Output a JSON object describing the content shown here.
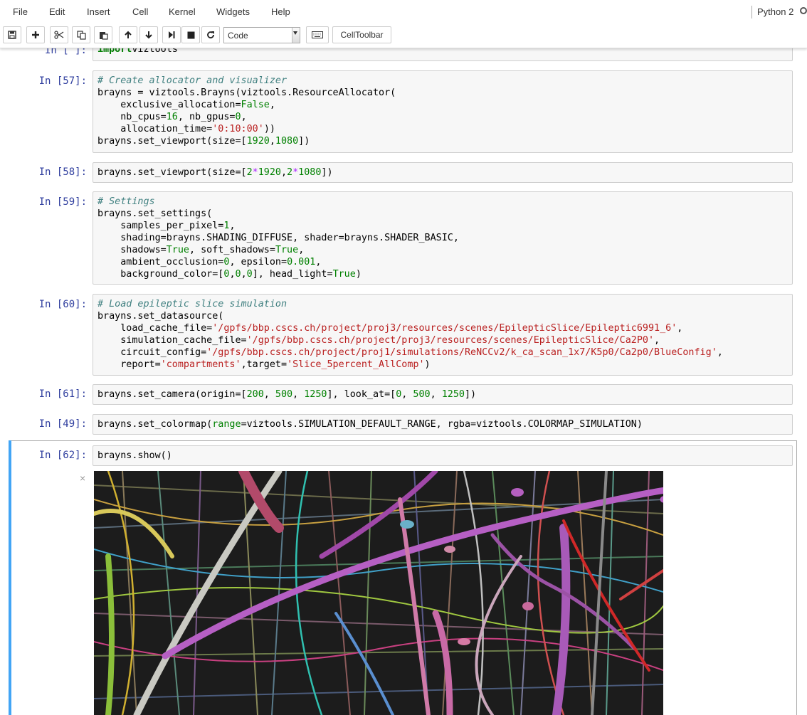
{
  "menubar": {
    "items": [
      "File",
      "Edit",
      "Insert",
      "Cell",
      "Kernel",
      "Widgets",
      "Help"
    ],
    "kernel": "Python 2"
  },
  "toolbar": {
    "icons": [
      "save-icon",
      "insert-cell-below-icon",
      "cut-icon",
      "copy-icon",
      "paste-icon",
      "move-up-icon",
      "move-down-icon",
      "run-cell-icon",
      "interrupt-kernel-icon",
      "restart-kernel-icon",
      "keyboard-icon"
    ],
    "cell_type": "Code",
    "celltoolbar_label": "CellToolbar"
  },
  "cells": [
    {
      "prompt": "In [ ]:",
      "lines": [
        [
          [
            "kw",
            "import"
          ],
          [
            "",
            "viztools"
          ]
        ]
      ]
    },
    {
      "prompt": "In [57]:",
      "lines": [
        [
          [
            "cm",
            "# Create allocator and visualizer"
          ]
        ],
        [
          [
            "",
            "brayns = viztools.Brayns(viztools.ResourceAllocator("
          ]
        ],
        [
          [
            "",
            "    exclusive_allocation="
          ],
          [
            "num",
            "False"
          ],
          [
            "",
            ","
          ]
        ],
        [
          [
            "",
            "    nb_cpus="
          ],
          [
            "num",
            "16"
          ],
          [
            "",
            ", nb_gpus="
          ],
          [
            "num",
            "0"
          ],
          [
            "",
            ","
          ]
        ],
        [
          [
            "",
            "    allocation_time="
          ],
          [
            "str",
            "'0:10:00'"
          ],
          [
            "",
            "))"
          ]
        ],
        [
          [
            "",
            "brayns.set_viewport(size=["
          ],
          [
            "num",
            "1920"
          ],
          [
            "",
            ","
          ],
          [
            "num",
            "1080"
          ],
          [
            "",
            "])"
          ]
        ]
      ]
    },
    {
      "prompt": "In [58]:",
      "lines": [
        [
          [
            "",
            "brayns.set_viewport(size=["
          ],
          [
            "num",
            "2"
          ],
          [
            "op",
            "*"
          ],
          [
            "num",
            "1920"
          ],
          [
            "",
            ","
          ],
          [
            "num",
            "2"
          ],
          [
            "op",
            "*"
          ],
          [
            "num",
            "1080"
          ],
          [
            "",
            "])"
          ]
        ]
      ]
    },
    {
      "prompt": "In [59]:",
      "lines": [
        [
          [
            "cm",
            "# Settings"
          ]
        ],
        [
          [
            "",
            "brayns.set_settings("
          ]
        ],
        [
          [
            "",
            "    samples_per_pixel="
          ],
          [
            "num",
            "1"
          ],
          [
            "",
            ","
          ]
        ],
        [
          [
            "",
            "    shading=brayns.SHADING_DIFFUSE, shader=brayns.SHADER_BASIC,"
          ]
        ],
        [
          [
            "",
            "    shadows="
          ],
          [
            "num",
            "True"
          ],
          [
            "",
            ", soft_shadows="
          ],
          [
            "num",
            "True"
          ],
          [
            "",
            ","
          ]
        ],
        [
          [
            "",
            "    ambient_occlusion="
          ],
          [
            "num",
            "0"
          ],
          [
            "",
            ", epsilon="
          ],
          [
            "num",
            "0.001"
          ],
          [
            "",
            ","
          ]
        ],
        [
          [
            "",
            "    background_color=["
          ],
          [
            "num",
            "0"
          ],
          [
            "",
            ","
          ],
          [
            "num",
            "0"
          ],
          [
            "",
            ","
          ],
          [
            "num",
            "0"
          ],
          [
            "",
            "], head_light="
          ],
          [
            "num",
            "True"
          ],
          [
            "",
            ")"
          ]
        ]
      ]
    },
    {
      "prompt": "In [60]:",
      "lines": [
        [
          [
            "cm",
            "# Load epileptic slice simulation"
          ]
        ],
        [
          [
            "",
            "brayns.set_datasource("
          ]
        ],
        [
          [
            "",
            "    load_cache_file="
          ],
          [
            "str",
            "'/gpfs/bbp.cscs.ch/project/proj3/resources/scenes/EpilepticSlice/Epileptic6991_6'"
          ],
          [
            "",
            ","
          ]
        ],
        [
          [
            "",
            "    simulation_cache_file="
          ],
          [
            "str",
            "'/gpfs/bbp.cscs.ch/project/proj3/resources/scenes/EpilepticSlice/Ca2P0'"
          ],
          [
            "",
            ","
          ]
        ],
        [
          [
            "",
            "    circuit_config="
          ],
          [
            "str",
            "'/gpfs/bbp.cscs.ch/project/proj1/simulations/ReNCCv2/k_ca_scan_1x7/K5p0/Ca2p0/BlueConfig'"
          ],
          [
            "",
            ","
          ]
        ],
        [
          [
            "",
            "    report="
          ],
          [
            "str",
            "'compartments'"
          ],
          [
            "",
            ",target="
          ],
          [
            "str",
            "'Slice_5percent_AllComp'"
          ],
          [
            "",
            ")"
          ]
        ]
      ]
    },
    {
      "prompt": "In [61]:",
      "lines": [
        [
          [
            "",
            "brayns.set_camera(origin=["
          ],
          [
            "num",
            "200"
          ],
          [
            "",
            ", "
          ],
          [
            "num",
            "500"
          ],
          [
            "",
            ", "
          ],
          [
            "num",
            "1250"
          ],
          [
            "",
            "], look_at=["
          ],
          [
            "num",
            "0"
          ],
          [
            "",
            ", "
          ],
          [
            "num",
            "500"
          ],
          [
            "",
            ", "
          ],
          [
            "num",
            "1250"
          ],
          [
            "",
            "])"
          ]
        ]
      ]
    },
    {
      "prompt": "In [49]:",
      "lines": [
        [
          [
            "",
            "brayns.set_colormap("
          ],
          [
            "num",
            "range"
          ],
          [
            "",
            "=viztools.SIMULATION_DEFAULT_RANGE, rgba=viztools.COLORMAP_SIMULATION)"
          ]
        ]
      ]
    },
    {
      "prompt": "In [62]:",
      "lines": [
        [
          [
            "",
            "brayns.show()"
          ]
        ]
      ]
    }
  ],
  "output_close": "×"
}
